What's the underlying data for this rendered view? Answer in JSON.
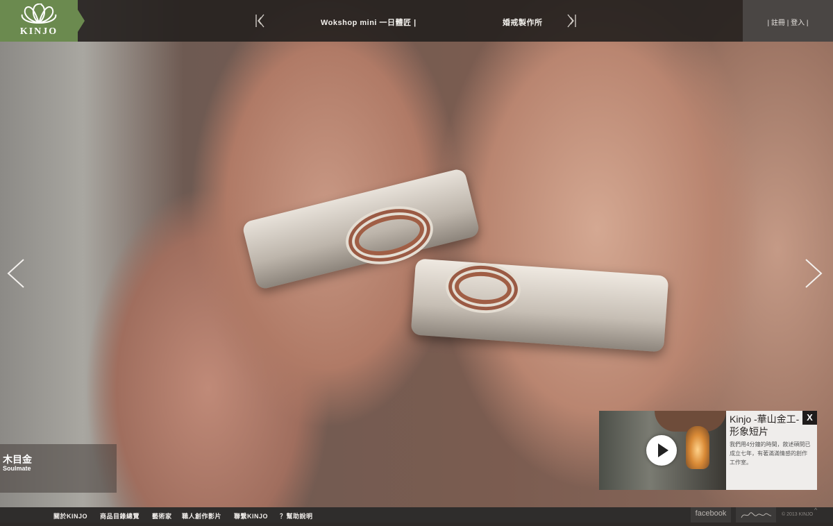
{
  "brand": {
    "logo_text": "KINJO"
  },
  "header": {
    "nav": [
      {
        "label": "Wokshop mini  一日體匠  |"
      },
      {
        "label": "婚戒製作所"
      }
    ],
    "auth": "| 註冊 | 登入 |"
  },
  "slide": {
    "title": "木目金",
    "subtitle": "Soulmate"
  },
  "video_popup": {
    "title": "Kinjo -華山金工-形象短片",
    "description": "我們用4分鐘的時間，敘述碩問已成立七年，有著滿滿情感的創作工作室。",
    "close_label": "X"
  },
  "footer": {
    "links": [
      {
        "label": "關於KINJO"
      },
      {
        "label": "商品目錄總覽"
      },
      {
        "label": "藝術家"
      },
      {
        "label": "職人創作影片"
      },
      {
        "label": "聯繫KINJO"
      },
      {
        "label": "？幫助說明"
      }
    ],
    "facebook": "facebook",
    "copyright": "© 2013 KINJO",
    "scroll_mark": "^"
  },
  "colors": {
    "brand_green": "#6b8a4f",
    "topbar": "#262220",
    "footer": "#2f2d2c"
  },
  "icons": [
    "fan-logo-icon",
    "nav-deco-left-icon",
    "nav-deco-right-icon",
    "chevron-left-icon",
    "chevron-right-icon",
    "play-icon",
    "signature-icon"
  ]
}
